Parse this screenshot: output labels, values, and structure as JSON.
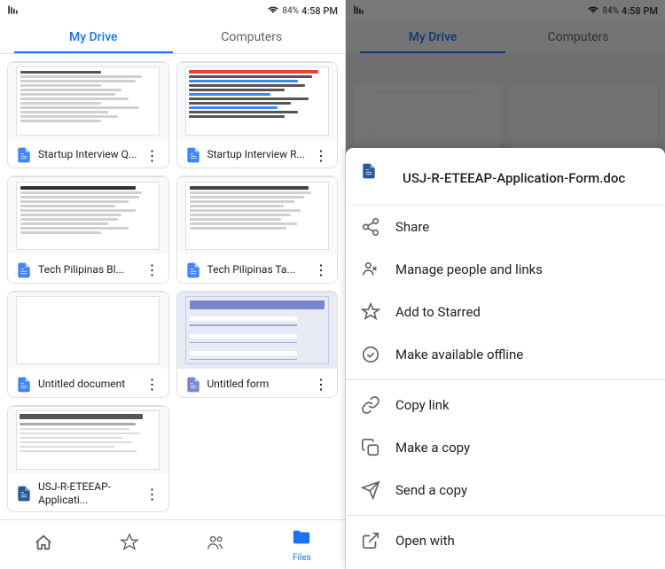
{
  "left": {
    "status": {
      "time": "4:58 PM",
      "battery": "84%",
      "icons": "📶 📡 🔋"
    },
    "tabs": [
      {
        "label": "My Drive",
        "active": true
      },
      {
        "label": "Computers",
        "active": false
      }
    ],
    "files": [
      {
        "id": "f1",
        "name": "Startup Interview Q...",
        "type": "docs",
        "preview": "doc"
      },
      {
        "id": "f2",
        "name": "Startup Interview R...",
        "type": "docs",
        "preview": "doc-colored"
      },
      {
        "id": "f3",
        "name": "Tech Pilipinas Bl...",
        "type": "docs",
        "preview": "doc"
      },
      {
        "id": "f4",
        "name": "Tech Pilipinas Ta...",
        "type": "docs",
        "preview": "doc"
      },
      {
        "id": "f5",
        "name": "Untitled document",
        "type": "docs",
        "preview": "blank"
      },
      {
        "id": "f6",
        "name": "Untitled form",
        "type": "forms",
        "preview": "form"
      },
      {
        "id": "f7",
        "name": "USJ-R-ETEEAP-Applicati...",
        "type": "word",
        "preview": "app-form"
      }
    ],
    "nav": [
      {
        "label": "",
        "icon": "🏠",
        "active": false,
        "name": "home"
      },
      {
        "label": "",
        "icon": "☆",
        "active": false,
        "name": "starred"
      },
      {
        "label": "",
        "icon": "👤",
        "active": false,
        "name": "shared"
      },
      {
        "label": "Files",
        "icon": "📁",
        "active": true,
        "name": "files"
      }
    ]
  },
  "right": {
    "status": {
      "time": "4:58 PM",
      "battery": "84%"
    },
    "tabs": [
      {
        "label": "My Drive",
        "active": true
      },
      {
        "label": "Computers",
        "active": false
      }
    ],
    "bottomSheet": {
      "fileName": "USJ-R-ETEEAP-Application-Form.doc",
      "fileType": "word",
      "menuItems": [
        {
          "id": "share",
          "label": "Share",
          "icon": "share"
        },
        {
          "id": "manage",
          "label": "Manage people and links",
          "icon": "manage"
        },
        {
          "id": "star",
          "label": "Add to Starred",
          "icon": "star"
        },
        {
          "id": "offline",
          "label": "Make available offline",
          "icon": "offline"
        },
        {
          "id": "divider1"
        },
        {
          "id": "copylink",
          "label": "Copy link",
          "icon": "link"
        },
        {
          "id": "makecopy",
          "label": "Make a copy",
          "icon": "copy"
        },
        {
          "id": "sendcopy",
          "label": "Send a copy",
          "icon": "send"
        },
        {
          "id": "divider2"
        },
        {
          "id": "openwith",
          "label": "Open with",
          "icon": "open"
        }
      ]
    }
  }
}
